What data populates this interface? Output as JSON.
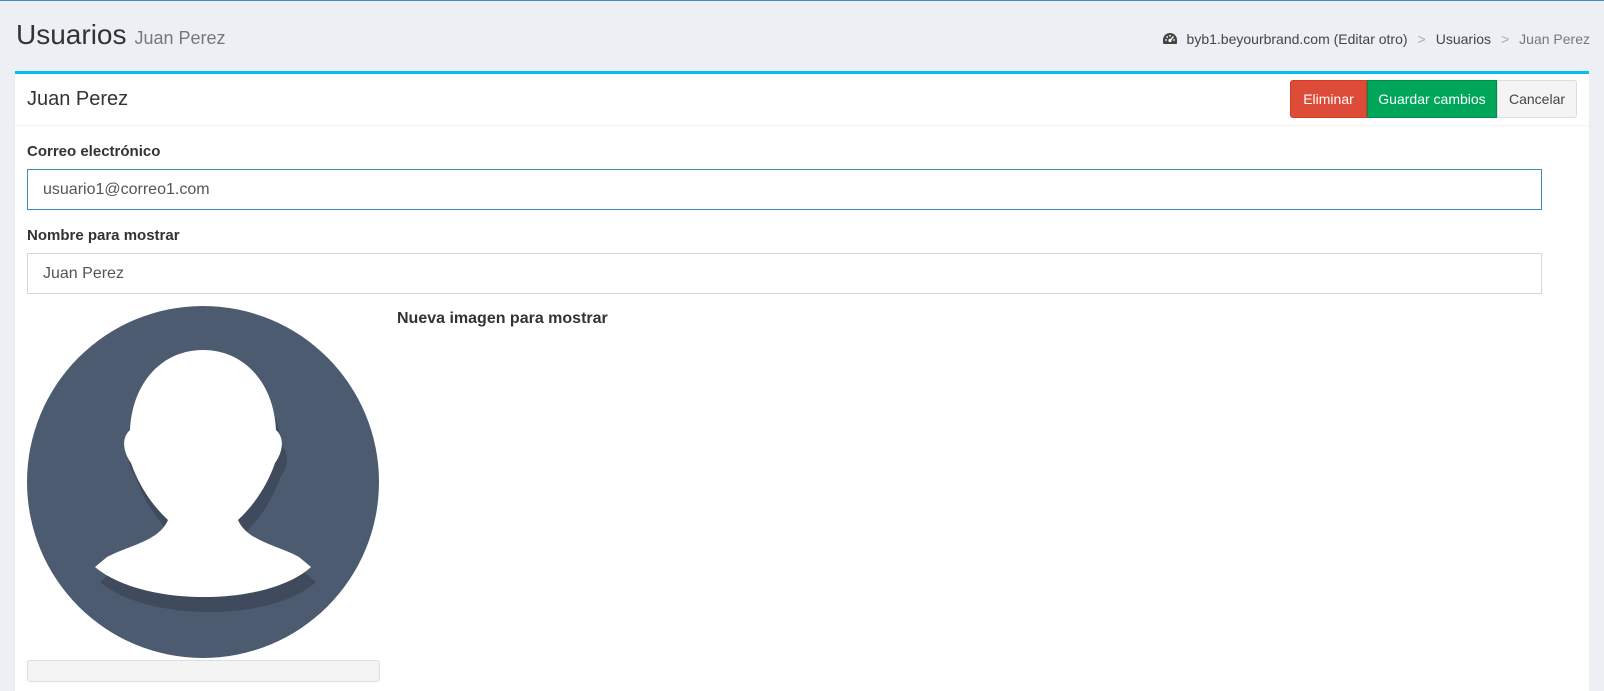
{
  "header": {
    "title": "Usuarios",
    "subtitle": "Juan Perez"
  },
  "breadcrumb": {
    "icon": "dashboard-icon",
    "site": "byb1.beyourbrand.com (Editar otro)",
    "separator": ">",
    "section": "Usuarios",
    "current": "Juan Perez"
  },
  "box": {
    "title": "Juan Perez",
    "accent_color": "#00c0ef"
  },
  "actions": {
    "delete_label": "Eliminar",
    "save_label": "Guardar cambios",
    "cancel_label": "Cancelar",
    "delete_color": "#dd4b39",
    "save_color": "#00a65a"
  },
  "form": {
    "email_label": "Correo electrónico",
    "email_value": "usuario1@correo1.com",
    "display_name_label": "Nombre para mostrar",
    "display_name_value": "Juan Perez",
    "new_image_label": "Nueva imagen para mostrar",
    "avatar_icon": "user-silhouette-icon",
    "avatar_color": "#4c5b70"
  }
}
